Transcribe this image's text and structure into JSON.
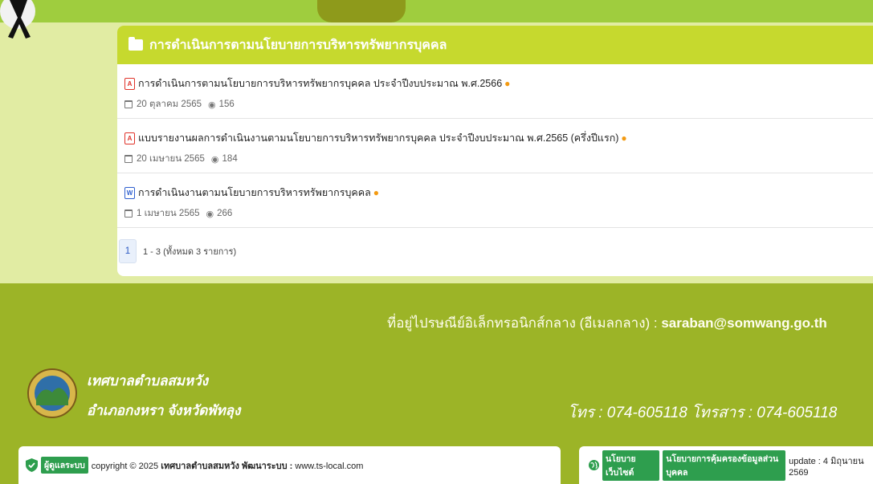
{
  "colors": {
    "page_bg": "#e1eca3",
    "top_bar": "#9fcd3e",
    "panel_header": "#c6d92e",
    "footer_bg": "#9cb427",
    "tag_green": "#2e9e4e"
  },
  "panel": {
    "title": "การดำเนินการตามนโยบายการบริหารทรัพยากรบุคคล",
    "items": [
      {
        "icon": "pdf-icon",
        "title": "การดำเนินการตามนโยบายการบริหารทรัพยากรบุคคล ประจำปีงบประมาณ พ.ศ.2566",
        "date": "20 ตุลาคม 2565",
        "views": "156"
      },
      {
        "icon": "pdf-icon",
        "title": "แบบรายงานผลการดำเนินงานตามนโยบายการบริหารทรัพยากรบุคคล ประจำปีงบประมาณ พ.ศ.2565 (ครึ่งปีแรก)",
        "date": "20 เมษายน 2565",
        "views": "184"
      },
      {
        "icon": "word-icon",
        "title": "การดำเนินงานตามนโยบายการบริหารทรัพยากรบุคคล",
        "date": "1 เมษายน 2565",
        "views": "266"
      }
    ],
    "pagination": {
      "current_page": "1",
      "summary": "1 - 3 (ทั้งหมด 3 รายการ)"
    }
  },
  "footer": {
    "email_label": "ที่อยู่ไปรษณีย์อิเล็กทรอนิกส์กลาง (อีเมลกลาง) :",
    "email": "saraban@somwang.go.th",
    "org_name": "เทศบาลตำบลสมหวัง",
    "org_sub": "อำเภอกงหรา จังหวัดพัทลุง",
    "phone": "โทร : 074-605118 โทรสาร : 074-605118",
    "admin_tag": "ผู้ดูแลระบบ",
    "copyright": "copyright © 2025",
    "copyright_org": "เทศบาลตำบลสมหวัง",
    "developer_label": "พัฒนาระบบ :",
    "developer_site": "www.ts-local.com",
    "website_policy_tag": "นโยบายเว็บไซต์",
    "privacy_policy_tag": "นโยบายการคุ้มครองข้อมูลส่วนบุคคล",
    "update_text": "update : 4 มิถุนายน 2569"
  }
}
